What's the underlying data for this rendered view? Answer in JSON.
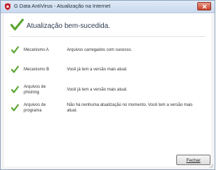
{
  "window": {
    "title": "G Data AntiVirus - Atualização na Internet",
    "icon": "gdata-shield-icon"
  },
  "header": {
    "title": "Atualização bem-sucedida.",
    "icon": "check-icon"
  },
  "rows": [
    {
      "name": "Mecanismo A",
      "message": "Arquivos carregados com sucesso."
    },
    {
      "name": "Mecanismo B",
      "message": "Você já tem a versão mais atual."
    },
    {
      "name": "Arquivos de phishing",
      "message": "Você já tem a versão mais atual."
    },
    {
      "name": "Arquivos de programa",
      "message": "Não há nenhuma atualização no momento. Você tem a versão mais atual."
    }
  ],
  "buttons": {
    "close_label": "Fechar"
  },
  "colors": {
    "check_green": "#5aa532",
    "close_red": "#c7432c",
    "titlebar": "#c9d9ee"
  }
}
